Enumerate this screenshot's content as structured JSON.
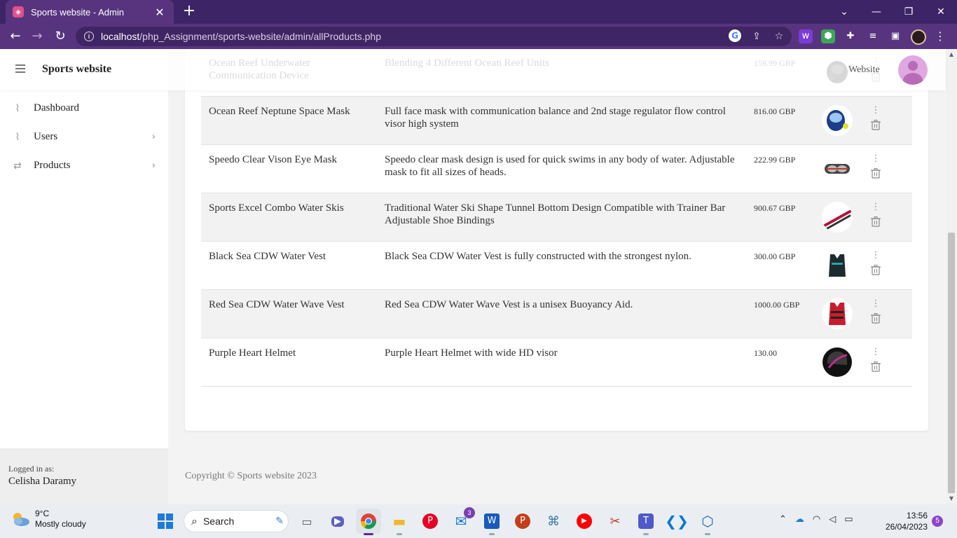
{
  "browser": {
    "tab_title": "Sports website - Admin",
    "tab_close": "✕",
    "new_tab": "+",
    "url_host": "localhost",
    "url_path": "/php_Assignment/sports-website/admin/allProducts.php"
  },
  "header": {
    "brand": "Sports website",
    "website_link": "Website"
  },
  "sidebar": {
    "items": [
      {
        "label": "Dashboard",
        "icon": "activity-icon",
        "has_chevron": false
      },
      {
        "label": "Users",
        "icon": "activity-icon",
        "has_chevron": true
      },
      {
        "label": "Products",
        "icon": "repeat-icon",
        "has_chevron": true
      }
    ],
    "logged_in_label": "Logged in as:",
    "logged_in_user": "Celisha Daramy"
  },
  "products": [
    {
      "name": "Ocean Reef Underwater Communication Device",
      "description": "Blending 4 Different Ocean Reef Units",
      "price": "159.99 GBP",
      "thumb": "diving-mask-black"
    },
    {
      "name": "Ocean Reef Neptune Space Mask",
      "description": "Full face mask with communication balance and 2nd stage regulator flow control visor high system",
      "price": "816.00 GBP",
      "thumb": "full-face-mask"
    },
    {
      "name": "Speedo Clear Vison Eye Mask",
      "description": "Speedo clear mask design is used for quick swims in any body of water. Adjustable mask to fit all sizes of heads.",
      "price": "222.99 GBP",
      "thumb": "eye-mask"
    },
    {
      "name": "Sports Excel Combo Water Skis",
      "description": "Traditional Water Ski Shape Tunnel Bottom Design Compatible with Trainer Bar Adjustable Shoe Bindings",
      "price": "900.67 GBP",
      "thumb": "water-skis"
    },
    {
      "name": "Black Sea CDW Water Vest",
      "description": "Black Sea CDW Water Vest is fully constructed with the strongest nylon.",
      "price": "300.00 GBP",
      "thumb": "black-vest"
    },
    {
      "name": "Red Sea CDW Water Wave Vest",
      "description": "Red Sea CDW Water Wave Vest is a unisex Buoyancy Aid.",
      "price": "1000.00 GBP",
      "thumb": "red-vest"
    },
    {
      "name": "Purple Heart Helmet",
      "description": "Purple Heart Helmet with wide HD visor",
      "price": "130.00",
      "thumb": "helmet"
    }
  ],
  "footer": {
    "copyright": "Copyright © Sports website 2023"
  },
  "taskbar": {
    "weather_temp": "9°C",
    "weather_desc": "Mostly cloudy",
    "search_label": "Search",
    "mail_badge": "3",
    "time": "13:56",
    "date": "26/04/2023",
    "notification_count": "5"
  }
}
